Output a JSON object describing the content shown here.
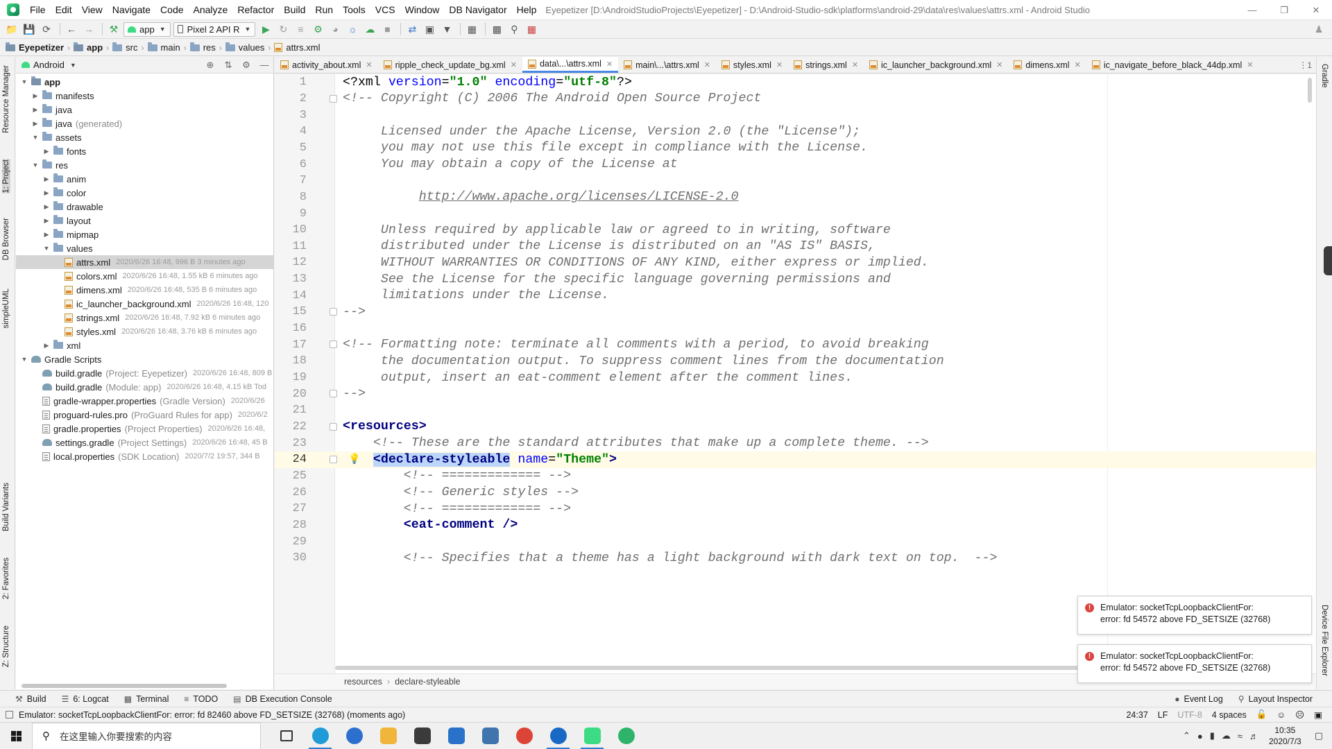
{
  "window": {
    "title": "Eyepetizer [D:\\AndroidStudioProjects\\Eyepetizer] - D:\\Android-Studio-sdk\\platforms\\android-29\\data\\res\\values\\attrs.xml - Android Studio"
  },
  "menu": [
    "File",
    "Edit",
    "View",
    "Navigate",
    "Code",
    "Analyze",
    "Refactor",
    "Build",
    "Run",
    "Tools",
    "VCS",
    "Window",
    "DB Navigator",
    "Help"
  ],
  "toolbar": {
    "run_config": "app",
    "device": "Pixel 2 API R"
  },
  "breadcrumb": [
    "Eyepetizer",
    "app",
    "src",
    "main",
    "res",
    "values",
    "attrs.xml"
  ],
  "left_strip": {
    "tabs": [
      "Resource Manager",
      "1: Project",
      "DB Browser",
      "simpleUML",
      "Build Variants",
      "2: Favorites",
      "Z: Structure"
    ]
  },
  "right_strip": {
    "tabs": [
      "Gradle",
      "Device File Explorer"
    ]
  },
  "project": {
    "view": "Android",
    "tree": [
      {
        "label": "app",
        "hint": "",
        "meta": "",
        "depth": 0,
        "expanded": true,
        "icon": "module-folder-icon",
        "bold": true
      },
      {
        "label": "manifests",
        "hint": "",
        "meta": "",
        "depth": 1,
        "expanded": false,
        "icon": "folder-icon"
      },
      {
        "label": "java",
        "hint": "",
        "meta": "",
        "depth": 1,
        "expanded": false,
        "icon": "folder-icon"
      },
      {
        "label": "java",
        "hint": "(generated)",
        "meta": "",
        "depth": 1,
        "expanded": false,
        "icon": "folder-icon"
      },
      {
        "label": "assets",
        "hint": "",
        "meta": "",
        "depth": 1,
        "expanded": true,
        "icon": "folder-icon"
      },
      {
        "label": "fonts",
        "hint": "",
        "meta": "",
        "depth": 2,
        "expanded": false,
        "icon": "folder-icon"
      },
      {
        "label": "res",
        "hint": "",
        "meta": "",
        "depth": 1,
        "expanded": true,
        "icon": "folder-icon"
      },
      {
        "label": "anim",
        "hint": "",
        "meta": "",
        "depth": 2,
        "expanded": false,
        "icon": "folder-icon"
      },
      {
        "label": "color",
        "hint": "",
        "meta": "",
        "depth": 2,
        "expanded": false,
        "icon": "folder-icon"
      },
      {
        "label": "drawable",
        "hint": "",
        "meta": "",
        "depth": 2,
        "expanded": false,
        "icon": "folder-icon"
      },
      {
        "label": "layout",
        "hint": "",
        "meta": "",
        "depth": 2,
        "expanded": false,
        "icon": "folder-icon"
      },
      {
        "label": "mipmap",
        "hint": "",
        "meta": "",
        "depth": 2,
        "expanded": false,
        "icon": "folder-icon"
      },
      {
        "label": "values",
        "hint": "",
        "meta": "",
        "depth": 2,
        "expanded": true,
        "icon": "folder-icon"
      },
      {
        "label": "attrs.xml",
        "hint": "",
        "meta": "2020/6/26 16:48, 996 B 3 minutes ago",
        "depth": 3,
        "icon": "xml-file-icon",
        "selected": true
      },
      {
        "label": "colors.xml",
        "hint": "",
        "meta": "2020/6/26 16:48, 1.55 kB 6 minutes ago",
        "depth": 3,
        "icon": "xml-file-icon"
      },
      {
        "label": "dimens.xml",
        "hint": "",
        "meta": "2020/6/26 16:48, 535 B 6 minutes ago",
        "depth": 3,
        "icon": "xml-file-icon"
      },
      {
        "label": "ic_launcher_background.xml",
        "hint": "",
        "meta": "2020/6/26 16:48, 120",
        "depth": 3,
        "icon": "xml-file-icon"
      },
      {
        "label": "strings.xml",
        "hint": "",
        "meta": "2020/6/26 16:48, 7.92 kB 6 minutes ago",
        "depth": 3,
        "icon": "xml-file-icon"
      },
      {
        "label": "styles.xml",
        "hint": "",
        "meta": "2020/6/26 16:48, 3.76 kB 6 minutes ago",
        "depth": 3,
        "icon": "xml-file-icon"
      },
      {
        "label": "xml",
        "hint": "",
        "meta": "",
        "depth": 2,
        "expanded": false,
        "icon": "folder-icon"
      },
      {
        "label": "Gradle Scripts",
        "hint": "",
        "meta": "",
        "depth": 0,
        "expanded": true,
        "icon": "gradle-icon"
      },
      {
        "label": "build.gradle",
        "hint": "(Project: Eyepetizer)",
        "meta": "2020/6/26 16:48, 809 B",
        "depth": 1,
        "icon": "gradle-icon"
      },
      {
        "label": "build.gradle",
        "hint": "(Module: app)",
        "meta": "2020/6/26 16:48, 4.15 kB Tod",
        "depth": 1,
        "icon": "gradle-icon"
      },
      {
        "label": "gradle-wrapper.properties",
        "hint": "(Gradle Version)",
        "meta": "2020/6/26",
        "depth": 1,
        "icon": "properties-file-icon"
      },
      {
        "label": "proguard-rules.pro",
        "hint": "(ProGuard Rules for app)",
        "meta": "2020/6/2",
        "depth": 1,
        "icon": "properties-file-icon"
      },
      {
        "label": "gradle.properties",
        "hint": "(Project Properties)",
        "meta": "2020/6/26 16:48,",
        "depth": 1,
        "icon": "properties-file-icon"
      },
      {
        "label": "settings.gradle",
        "hint": "(Project Settings)",
        "meta": "2020/6/26 16:48, 45 B",
        "depth": 1,
        "icon": "gradle-icon"
      },
      {
        "label": "local.properties",
        "hint": "(SDK Location)",
        "meta": "2020/7/2 19:57, 344 B",
        "depth": 1,
        "icon": "properties-file-icon"
      }
    ]
  },
  "tabs": [
    {
      "label": "activity_about.xml",
      "active": false
    },
    {
      "label": "ripple_check_update_bg.xml",
      "active": false
    },
    {
      "label": "data\\...\\attrs.xml",
      "active": true
    },
    {
      "label": "main\\...\\attrs.xml",
      "active": false
    },
    {
      "label": "styles.xml",
      "active": false
    },
    {
      "label": "strings.xml",
      "active": false
    },
    {
      "label": "ic_launcher_background.xml",
      "active": false
    },
    {
      "label": "dimens.xml",
      "active": false
    },
    {
      "label": "ic_navigate_before_black_44dp.xml",
      "active": false
    }
  ],
  "tabs_overflow": "⋮1",
  "editor": {
    "caret_line": 24,
    "lines": [
      {
        "n": "1",
        "fold": false,
        "segs": [
          [
            "pi",
            "<?xml "
          ],
          [
            "attr",
            "version"
          ],
          [
            "pi",
            "="
          ],
          [
            "str",
            "\"1.0\""
          ],
          [
            "pi",
            " "
          ],
          [
            "attr",
            "encoding"
          ],
          [
            "pi",
            "="
          ],
          [
            "str",
            "\"utf-8\""
          ],
          [
            "pi",
            "?>"
          ]
        ]
      },
      {
        "n": "2",
        "fold": true,
        "segs": [
          [
            "com",
            "<!-- Copyright (C) 2006 The Android Open Source Project"
          ]
        ]
      },
      {
        "n": "3",
        "fold": false,
        "segs": []
      },
      {
        "n": "4",
        "fold": false,
        "segs": [
          [
            "com",
            "     Licensed under the Apache License, Version 2.0 (the \"License\");"
          ]
        ]
      },
      {
        "n": "5",
        "fold": false,
        "segs": [
          [
            "com",
            "     you may not use this file except in compliance with the License."
          ]
        ]
      },
      {
        "n": "6",
        "fold": false,
        "segs": [
          [
            "com",
            "     You may obtain a copy of the License at"
          ]
        ]
      },
      {
        "n": "7",
        "fold": false,
        "segs": []
      },
      {
        "n": "8",
        "fold": false,
        "segs": [
          [
            "com",
            "          "
          ],
          [
            "link",
            "http://www.apache.org/licenses/LICENSE-2.0"
          ]
        ]
      },
      {
        "n": "9",
        "fold": false,
        "segs": []
      },
      {
        "n": "10",
        "fold": false,
        "segs": [
          [
            "com",
            "     Unless required by applicable law or agreed to in writing, software"
          ]
        ]
      },
      {
        "n": "11",
        "fold": false,
        "segs": [
          [
            "com",
            "     distributed under the License is distributed on an \"AS IS\" BASIS,"
          ]
        ]
      },
      {
        "n": "12",
        "fold": false,
        "segs": [
          [
            "com",
            "     WITHOUT WARRANTIES OR CONDITIONS OF ANY KIND, either express or implied."
          ]
        ]
      },
      {
        "n": "13",
        "fold": false,
        "segs": [
          [
            "com",
            "     See the License for the specific language governing permissions and"
          ]
        ]
      },
      {
        "n": "14",
        "fold": false,
        "segs": [
          [
            "com",
            "     limitations under the License."
          ]
        ]
      },
      {
        "n": "15",
        "fold": true,
        "segs": [
          [
            "com",
            "-->"
          ]
        ]
      },
      {
        "n": "16",
        "fold": false,
        "segs": []
      },
      {
        "n": "17",
        "fold": true,
        "segs": [
          [
            "com",
            "<!-- Formatting note: terminate all comments with a period, to avoid breaking"
          ]
        ]
      },
      {
        "n": "18",
        "fold": false,
        "segs": [
          [
            "com",
            "     the documentation output. To suppress comment lines from the documentation"
          ]
        ]
      },
      {
        "n": "19",
        "fold": false,
        "segs": [
          [
            "com",
            "     output, insert an eat-comment element after the comment lines."
          ]
        ]
      },
      {
        "n": "20",
        "fold": true,
        "segs": [
          [
            "com",
            "-->"
          ]
        ]
      },
      {
        "n": "21",
        "fold": false,
        "segs": []
      },
      {
        "n": "22",
        "fold": true,
        "segs": [
          [
            "tag",
            "<resources>"
          ]
        ]
      },
      {
        "n": "23",
        "fold": false,
        "segs": [
          [
            "pi",
            "    "
          ],
          [
            "com",
            "<!-- These are the standard attributes that make up a complete theme. -->"
          ]
        ]
      },
      {
        "n": "24",
        "fold": true,
        "segs": [
          [
            "pi",
            "    "
          ],
          [
            "sel",
            "<declare-styleable"
          ],
          [
            "pi",
            " "
          ],
          [
            "attr",
            "name"
          ],
          [
            "pi",
            "="
          ],
          [
            "str",
            "\"Theme\""
          ],
          [
            "tag",
            ">"
          ]
        ]
      },
      {
        "n": "25",
        "fold": false,
        "segs": [
          [
            "pi",
            "        "
          ],
          [
            "com",
            "<!-- ============= -->"
          ]
        ]
      },
      {
        "n": "26",
        "fold": false,
        "segs": [
          [
            "pi",
            "        "
          ],
          [
            "com",
            "<!-- Generic styles -->"
          ]
        ]
      },
      {
        "n": "27",
        "fold": false,
        "segs": [
          [
            "pi",
            "        "
          ],
          [
            "com",
            "<!-- ============= -->"
          ]
        ]
      },
      {
        "n": "28",
        "fold": false,
        "segs": [
          [
            "pi",
            "        "
          ],
          [
            "tag",
            "<eat-comment />"
          ]
        ]
      },
      {
        "n": "29",
        "fold": false,
        "segs": []
      },
      {
        "n": "30",
        "fold": false,
        "segs": [
          [
            "pi",
            "        "
          ],
          [
            "com",
            "<!-- Specifies that a theme has a light background with dark text on top.  -->"
          ]
        ]
      }
    ],
    "crumb": [
      "resources",
      "declare-styleable"
    ]
  },
  "notifications": [
    {
      "text1": "Emulator: socketTcpLoopbackClientFor:",
      "text2": "error: fd 54572 above FD_SETSIZE (32768)"
    },
    {
      "text1": "Emulator: socketTcpLoopbackClientFor:",
      "text2": "error: fd 54572 above FD_SETSIZE (32768)"
    }
  ],
  "bottom_tools": {
    "left": [
      {
        "label": "Build",
        "icon": "hammer-icon"
      },
      {
        "label": "6: Logcat",
        "icon": "logcat-icon"
      },
      {
        "label": "Terminal",
        "icon": "terminal-icon"
      },
      {
        "label": "TODO",
        "icon": "todo-icon"
      },
      {
        "label": "DB Execution Console",
        "icon": "db-console-icon"
      }
    ],
    "right": [
      {
        "label": "Event Log",
        "icon": "event-log-icon"
      },
      {
        "label": "Layout Inspector",
        "icon": "layout-inspector-icon"
      }
    ]
  },
  "status": {
    "message": "Emulator: socketTcpLoopbackClientFor: error: fd 82460 above FD_SETSIZE (32768) (moments ago)",
    "position": "24:37",
    "line_sep": "LF",
    "encoding": "UTF-8",
    "indent": "4 spaces"
  },
  "taskbar": {
    "search_placeholder": "在这里输入你要搜索的内容",
    "time": "10:35",
    "date": "2020/7/3",
    "apps": [
      {
        "name": "task-view-icon",
        "color": "#333333"
      },
      {
        "name": "browser-can-icon",
        "color": "#1f9bd8",
        "active": true
      },
      {
        "name": "edge-icon",
        "color": "#2d6fce"
      },
      {
        "name": "file-explorer-icon",
        "color": "#f0b53a"
      },
      {
        "name": "store-icon",
        "color": "#3b3b3b"
      },
      {
        "name": "mail-icon",
        "color": "#2a72c9"
      },
      {
        "name": "python-icon",
        "color": "#3f74ad"
      },
      {
        "name": "chrome-icon",
        "color": "#db4437"
      },
      {
        "name": "kotlin-k-icon",
        "color": "#1769c4",
        "active": true
      },
      {
        "name": "android-studio-icon",
        "color": "#3ddc84",
        "active": true
      },
      {
        "name": "map-pin-icon",
        "color": "#2fb36b"
      }
    ]
  }
}
